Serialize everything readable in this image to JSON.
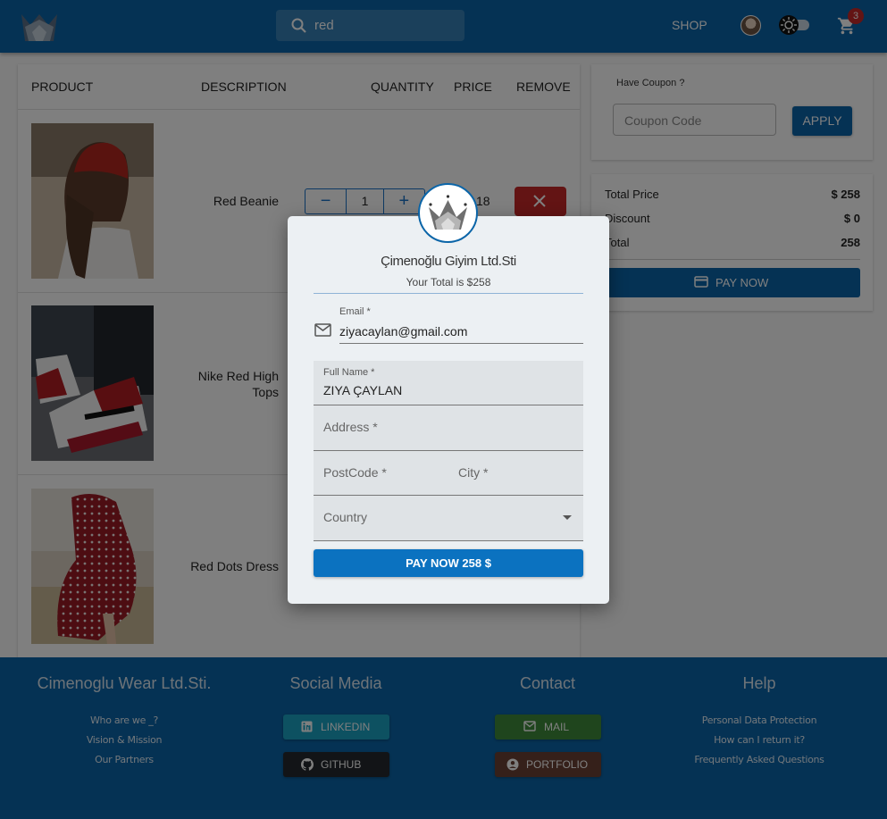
{
  "header": {
    "search_value": "red",
    "shop_label": "SHOP",
    "cart_count": "3",
    "logo_icon": "crown-logo-icon"
  },
  "cart": {
    "columns": [
      "PRODUCT",
      "DESCRIPTION",
      "QUANTITY",
      "PRICE",
      "REMOVE"
    ],
    "items": [
      {
        "name": "Red Beanie",
        "quantity": "1",
        "price": "18",
        "minus": "−",
        "plus": "+"
      },
      {
        "name": "Nike Red High Tops"
      },
      {
        "name": "Red Dots Dress"
      }
    ]
  },
  "coupon": {
    "title": "Have Coupon ?",
    "placeholder": "Coupon Code",
    "apply_label": "APPLY"
  },
  "totals": {
    "rows": [
      {
        "label": "Total Price",
        "value": "$ 258"
      },
      {
        "label": "Discount",
        "value": "$ 0"
      },
      {
        "label": "Total",
        "value": "258"
      }
    ],
    "pay_label": "PAY NOW"
  },
  "footer": {
    "company": {
      "title": "Cimenoglu Wear Ltd.Sti.",
      "links": [
        "Who are we _?",
        "Vision & Mission",
        "Our Partners"
      ]
    },
    "social": {
      "title": "Social Media",
      "linkedin": "LINKEDIN",
      "github": "GITHUB"
    },
    "contact": {
      "title": "Contact",
      "mail": "MAIL",
      "portfolio": "PORTFOLIO"
    },
    "help": {
      "title": "Help",
      "links": [
        "Personal Data Protection",
        "How can I return it?",
        "Frequently Asked Questions"
      ]
    }
  },
  "modal": {
    "company": "Çimenoğlu Giyim Ltd.Sti",
    "your_total": "Your Total is $258",
    "email_label": "Email *",
    "email_value": "ziyacaylan@gmail.com",
    "fullname_label": "Full Name *",
    "fullname_value": "ZIYA ÇAYLAN",
    "address_label": "Address *",
    "postcode_label": "PostCode *",
    "city_label": "City *",
    "country_label": "Country",
    "pay_label": "PAY NOW 258 $"
  },
  "colors": {
    "primary": "#0b65a8",
    "danger": "#c62828",
    "linkedin": "#1aa3c2",
    "mail": "#3f8b3a",
    "github": "#24292e",
    "portfolio": "#6b4135"
  }
}
